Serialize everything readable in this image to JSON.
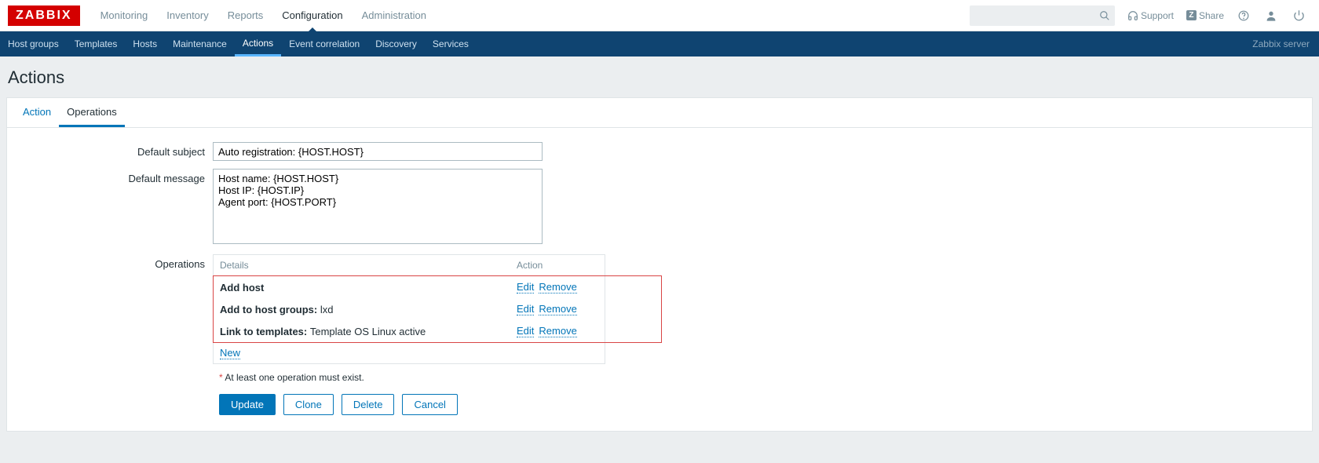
{
  "logo": "ZABBIX",
  "topnav": {
    "items": [
      "Monitoring",
      "Inventory",
      "Reports",
      "Configuration",
      "Administration"
    ],
    "active": 3
  },
  "topbar_right": {
    "support": "Support",
    "share": "Share"
  },
  "subnav": {
    "items": [
      "Host groups",
      "Templates",
      "Hosts",
      "Maintenance",
      "Actions",
      "Event correlation",
      "Discovery",
      "Services"
    ],
    "selected": 4,
    "server_label": "Zabbix server"
  },
  "page_title": "Actions",
  "tabs": {
    "items": [
      "Action",
      "Operations"
    ],
    "active": 1
  },
  "form": {
    "default_subject_label": "Default subject",
    "default_subject_value": "Auto registration: {HOST.HOST}",
    "default_message_label": "Default message",
    "default_message_value": "Host name: {HOST.HOST}\nHost IP: {HOST.IP}\nAgent port: {HOST.PORT}",
    "operations_label": "Operations",
    "ops_header_details": "Details",
    "ops_header_action": "Action",
    "ops_rows": [
      {
        "label": "Add host",
        "suffix": ""
      },
      {
        "label": "Add to host groups: ",
        "suffix": "lxd"
      },
      {
        "label": "Link to templates: ",
        "suffix": "Template OS Linux active"
      }
    ],
    "edit_label": "Edit",
    "remove_label": "Remove",
    "new_label": "New",
    "required_note": "At least one operation must exist."
  },
  "buttons": {
    "update": "Update",
    "clone": "Clone",
    "delete": "Delete",
    "cancel": "Cancel"
  }
}
